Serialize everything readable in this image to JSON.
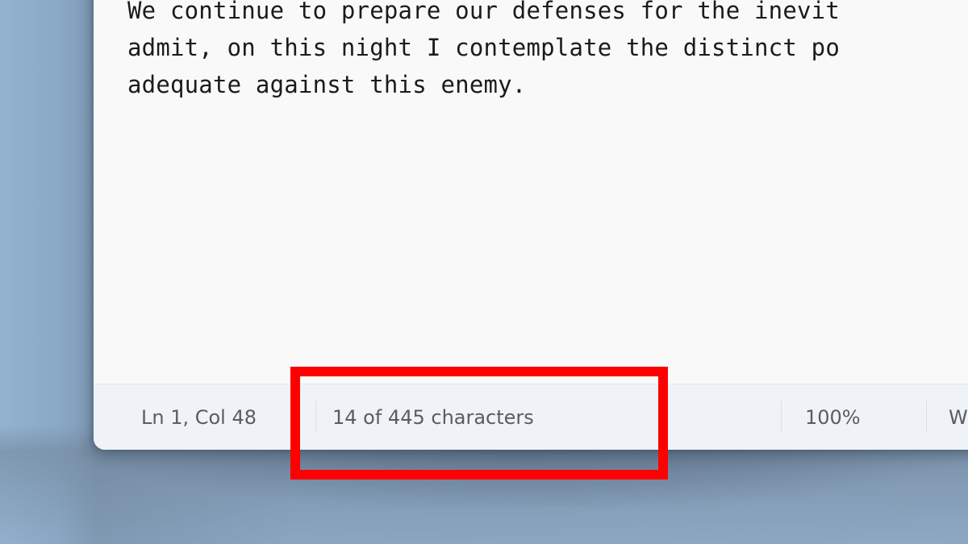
{
  "editor": {
    "lines": [
      "We continue to prepare our defenses for the inevit",
      "admit, on this night I contemplate the distinct po",
      "adequate against this enemy."
    ]
  },
  "statusbar": {
    "cursor_position": "Ln 1, Col 48",
    "character_count": "14 of 445 characters",
    "zoom_level": "100%",
    "line_ending_partial": "W"
  },
  "annotation": {
    "highlight_color": "#ff0000",
    "highlight_target": "character-count"
  }
}
